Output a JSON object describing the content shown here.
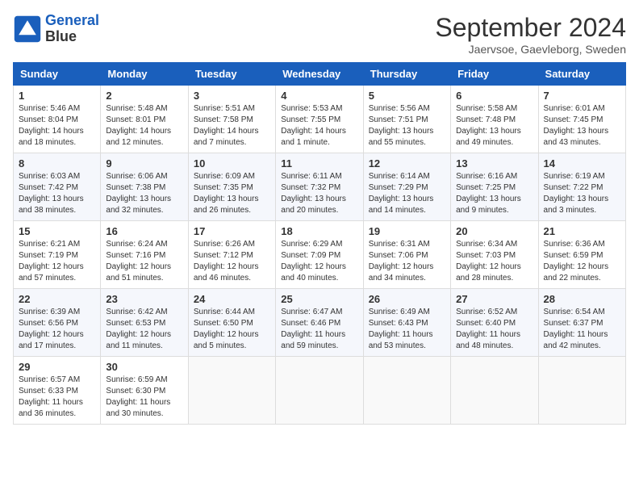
{
  "header": {
    "logo_line1": "General",
    "logo_line2": "Blue",
    "month": "September 2024",
    "location": "Jaervsoe, Gaevleborg, Sweden"
  },
  "weekdays": [
    "Sunday",
    "Monday",
    "Tuesday",
    "Wednesday",
    "Thursday",
    "Friday",
    "Saturday"
  ],
  "weeks": [
    [
      {
        "day": "1",
        "info": "Sunrise: 5:46 AM\nSunset: 8:04 PM\nDaylight: 14 hours\nand 18 minutes."
      },
      {
        "day": "2",
        "info": "Sunrise: 5:48 AM\nSunset: 8:01 PM\nDaylight: 14 hours\nand 12 minutes."
      },
      {
        "day": "3",
        "info": "Sunrise: 5:51 AM\nSunset: 7:58 PM\nDaylight: 14 hours\nand 7 minutes."
      },
      {
        "day": "4",
        "info": "Sunrise: 5:53 AM\nSunset: 7:55 PM\nDaylight: 14 hours\nand 1 minute."
      },
      {
        "day": "5",
        "info": "Sunrise: 5:56 AM\nSunset: 7:51 PM\nDaylight: 13 hours\nand 55 minutes."
      },
      {
        "day": "6",
        "info": "Sunrise: 5:58 AM\nSunset: 7:48 PM\nDaylight: 13 hours\nand 49 minutes."
      },
      {
        "day": "7",
        "info": "Sunrise: 6:01 AM\nSunset: 7:45 PM\nDaylight: 13 hours\nand 43 minutes."
      }
    ],
    [
      {
        "day": "8",
        "info": "Sunrise: 6:03 AM\nSunset: 7:42 PM\nDaylight: 13 hours\nand 38 minutes."
      },
      {
        "day": "9",
        "info": "Sunrise: 6:06 AM\nSunset: 7:38 PM\nDaylight: 13 hours\nand 32 minutes."
      },
      {
        "day": "10",
        "info": "Sunrise: 6:09 AM\nSunset: 7:35 PM\nDaylight: 13 hours\nand 26 minutes."
      },
      {
        "day": "11",
        "info": "Sunrise: 6:11 AM\nSunset: 7:32 PM\nDaylight: 13 hours\nand 20 minutes."
      },
      {
        "day": "12",
        "info": "Sunrise: 6:14 AM\nSunset: 7:29 PM\nDaylight: 13 hours\nand 14 minutes."
      },
      {
        "day": "13",
        "info": "Sunrise: 6:16 AM\nSunset: 7:25 PM\nDaylight: 13 hours\nand 9 minutes."
      },
      {
        "day": "14",
        "info": "Sunrise: 6:19 AM\nSunset: 7:22 PM\nDaylight: 13 hours\nand 3 minutes."
      }
    ],
    [
      {
        "day": "15",
        "info": "Sunrise: 6:21 AM\nSunset: 7:19 PM\nDaylight: 12 hours\nand 57 minutes."
      },
      {
        "day": "16",
        "info": "Sunrise: 6:24 AM\nSunset: 7:16 PM\nDaylight: 12 hours\nand 51 minutes."
      },
      {
        "day": "17",
        "info": "Sunrise: 6:26 AM\nSunset: 7:12 PM\nDaylight: 12 hours\nand 46 minutes."
      },
      {
        "day": "18",
        "info": "Sunrise: 6:29 AM\nSunset: 7:09 PM\nDaylight: 12 hours\nand 40 minutes."
      },
      {
        "day": "19",
        "info": "Sunrise: 6:31 AM\nSunset: 7:06 PM\nDaylight: 12 hours\nand 34 minutes."
      },
      {
        "day": "20",
        "info": "Sunrise: 6:34 AM\nSunset: 7:03 PM\nDaylight: 12 hours\nand 28 minutes."
      },
      {
        "day": "21",
        "info": "Sunrise: 6:36 AM\nSunset: 6:59 PM\nDaylight: 12 hours\nand 22 minutes."
      }
    ],
    [
      {
        "day": "22",
        "info": "Sunrise: 6:39 AM\nSunset: 6:56 PM\nDaylight: 12 hours\nand 17 minutes."
      },
      {
        "day": "23",
        "info": "Sunrise: 6:42 AM\nSunset: 6:53 PM\nDaylight: 12 hours\nand 11 minutes."
      },
      {
        "day": "24",
        "info": "Sunrise: 6:44 AM\nSunset: 6:50 PM\nDaylight: 12 hours\nand 5 minutes."
      },
      {
        "day": "25",
        "info": "Sunrise: 6:47 AM\nSunset: 6:46 PM\nDaylight: 11 hours\nand 59 minutes."
      },
      {
        "day": "26",
        "info": "Sunrise: 6:49 AM\nSunset: 6:43 PM\nDaylight: 11 hours\nand 53 minutes."
      },
      {
        "day": "27",
        "info": "Sunrise: 6:52 AM\nSunset: 6:40 PM\nDaylight: 11 hours\nand 48 minutes."
      },
      {
        "day": "28",
        "info": "Sunrise: 6:54 AM\nSunset: 6:37 PM\nDaylight: 11 hours\nand 42 minutes."
      }
    ],
    [
      {
        "day": "29",
        "info": "Sunrise: 6:57 AM\nSunset: 6:33 PM\nDaylight: 11 hours\nand 36 minutes."
      },
      {
        "day": "30",
        "info": "Sunrise: 6:59 AM\nSunset: 6:30 PM\nDaylight: 11 hours\nand 30 minutes."
      },
      {
        "day": "",
        "info": ""
      },
      {
        "day": "",
        "info": ""
      },
      {
        "day": "",
        "info": ""
      },
      {
        "day": "",
        "info": ""
      },
      {
        "day": "",
        "info": ""
      }
    ]
  ]
}
